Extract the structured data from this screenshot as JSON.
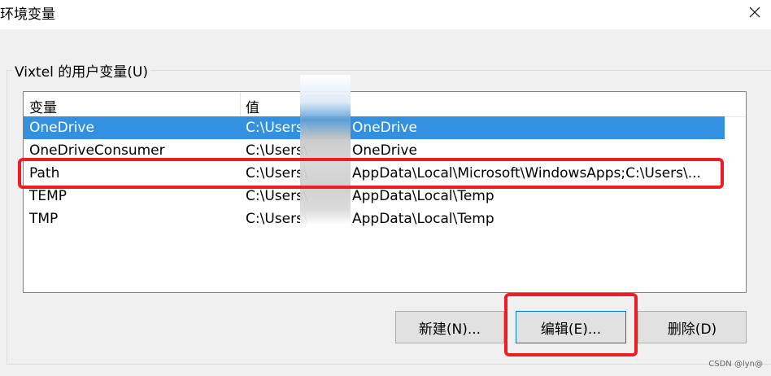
{
  "window": {
    "title": "环境变量"
  },
  "group": {
    "label": "Vixtel 的用户变量(U)"
  },
  "table": {
    "columns": [
      "变量",
      "值"
    ],
    "rows": [
      {
        "name": "OneDrive",
        "value_prefix": "C:\\Users\\",
        "value_suffix": "OneDrive",
        "selected": true
      },
      {
        "name": "OneDriveConsumer",
        "value_prefix": "C:\\Users\\",
        "value_suffix": "OneDrive",
        "selected": false
      },
      {
        "name": "Path",
        "value_prefix": "C:\\Users\\",
        "value_suffix": "AppData\\Local\\Microsoft\\WindowsApps;C:\\Users\\...",
        "selected": false
      },
      {
        "name": "TEMP",
        "value_prefix": "C:\\Users\\",
        "value_suffix": "AppData\\Local\\Temp",
        "selected": false
      },
      {
        "name": "TMP",
        "value_prefix": "C:\\Users\\",
        "value_suffix": "AppData\\Local\\Temp",
        "selected": false
      }
    ]
  },
  "buttons": {
    "new": "新建(N)...",
    "edit": "编辑(E)...",
    "delete": "删除(D)"
  },
  "watermark": "CSDN @lyn@",
  "colors": {
    "selection": "#3390e0",
    "highlight_box": "#ee1c25",
    "focus_border": "#0078d7"
  },
  "icons": {
    "close": "close-icon"
  }
}
